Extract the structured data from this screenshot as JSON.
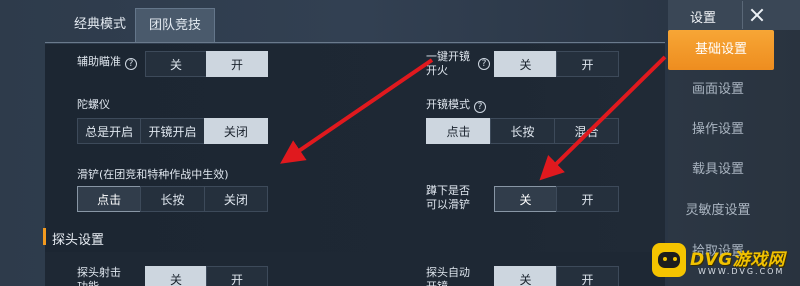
{
  "mode_tabs": [
    {
      "label": "经典模式"
    },
    {
      "label": "团队竞技"
    }
  ],
  "settings": {
    "aim_assist": {
      "label": "辅助瞄准",
      "options": [
        "关",
        "开"
      ],
      "selected": "开"
    },
    "one_key_scope_fire": {
      "label_line1": "一键开镜",
      "label_line2": "开火",
      "options": [
        "关",
        "开"
      ],
      "selected": "关"
    },
    "gyroscope": {
      "label": "陀螺仪",
      "options": [
        "总是开启",
        "开镜开启",
        "关闭"
      ],
      "selected": "关闭"
    },
    "scope_mode": {
      "label": "开镜模式",
      "options": [
        "点击",
        "长按",
        "混合"
      ],
      "selected": "点击"
    },
    "slide": {
      "label": "滑铲(在团竞和特种作战中生效)",
      "options": [
        "点击",
        "长按",
        "关闭"
      ],
      "selected": "点击"
    },
    "crouch_slide": {
      "label_line1": "蹲下是否",
      "label_line2": "可以滑铲",
      "options": [
        "关",
        "开"
      ],
      "selected": "关"
    }
  },
  "peek_section": {
    "title": "探头设置",
    "peek_shoot": {
      "label_line1": "探头射击",
      "label_line2": "功能",
      "options": [
        "关",
        "开"
      ]
    },
    "auto_peek": {
      "label_line1": "探头自动",
      "label_line2": "开镜",
      "options": [
        "关",
        "开"
      ]
    }
  },
  "menu": {
    "title": "设置",
    "items": [
      {
        "label": "基础设置",
        "active": true
      },
      {
        "label": "画面设置"
      },
      {
        "label": "操作设置"
      },
      {
        "label": "载具设置"
      },
      {
        "label": "灵敏度设置"
      },
      {
        "label": "拾取设置"
      }
    ]
  },
  "watermark": {
    "text": "DVG游戏网",
    "url": "WWW.DVG.COM"
  },
  "colors": {
    "accent": "#f29a1f",
    "arrow": "#e0191e",
    "watermark": "#f2c200"
  }
}
